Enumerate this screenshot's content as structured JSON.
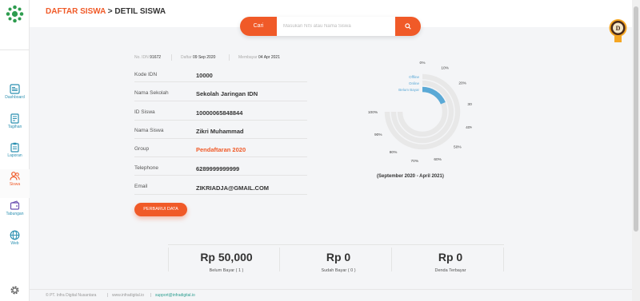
{
  "breadcrumb": {
    "parent": "DAFTAR SISWA",
    "separator": " > ",
    "current": "DETIL SISWA"
  },
  "search": {
    "label": "Cari",
    "placeholder": "Masukan NIS atau Nama Siswa"
  },
  "badge": {
    "letter": "D"
  },
  "sidebar": {
    "items": [
      {
        "label": "Dashboard",
        "icon": "dashboard-icon"
      },
      {
        "label": "Tagihan",
        "icon": "invoice-icon"
      },
      {
        "label": "Laporan",
        "icon": "report-icon"
      },
      {
        "label": "Siswa",
        "icon": "students-icon",
        "active": true
      },
      {
        "label": "Tabungan",
        "icon": "savings-icon"
      },
      {
        "label": "Web",
        "icon": "globe-icon"
      }
    ]
  },
  "meta": {
    "idn_label": "No. IDN",
    "idn_value": "91672",
    "daftar_label": "Daftar",
    "daftar_value": "09 Sep 2020",
    "membayar_label": "Membayar",
    "membayar_value": "04 Apr 2021"
  },
  "details": [
    {
      "label": "Kode IDN",
      "value": "10000"
    },
    {
      "label": "Nama Sekolah",
      "value": "Sekolah Jaringan IDN"
    },
    {
      "label": "ID Siswa",
      "value": "10000065848844"
    },
    {
      "label": "Nama Siswa",
      "value": "Zikri Muhammad"
    },
    {
      "label": "Group",
      "value": "Pendaftaran 2020"
    },
    {
      "label": "Telephone",
      "value": "6289999999999"
    },
    {
      "label": "Email",
      "value": "ZIKRIADJA@GMAIL.COM"
    }
  ],
  "update_button": "PERBARUI DATA",
  "chart_data": {
    "type": "radial-bar",
    "title": "",
    "caption": "(September 2020 - April 2021)",
    "tick_labels": [
      "0%",
      "10%",
      "20%",
      "30%",
      "40%",
      "50%",
      "60%",
      "70%",
      "80%",
      "90%",
      "100%"
    ],
    "max": 100,
    "series": [
      {
        "name": "Offline",
        "value": 0,
        "color": "#e8e8e8"
      },
      {
        "name": "Online",
        "value": 0,
        "color": "#e8e8e8"
      },
      {
        "name": "Belum Bayar",
        "value": 25,
        "color": "#5aa9d6"
      }
    ],
    "colors": {
      "track": "#e8e8e8",
      "label": "#5aa9d6"
    }
  },
  "totals": [
    {
      "amount": "Rp 50,000",
      "label": "Belum Bayar ( 1 )"
    },
    {
      "amount": "Rp 0",
      "label": "Sudah Bayar ( 0 )"
    },
    {
      "amount": "Rp 0",
      "label": "Denda Terbayar"
    }
  ],
  "footer": {
    "copyright": "© PT. Infra Digital Nusantara",
    "website": "www.infradigital.io",
    "email": "support@infradigital.io"
  },
  "colors": {
    "accent": "#f05a28",
    "logo": "#2e9c4f",
    "nav": "#2a8fb0",
    "active_nav": "#f05a28"
  }
}
